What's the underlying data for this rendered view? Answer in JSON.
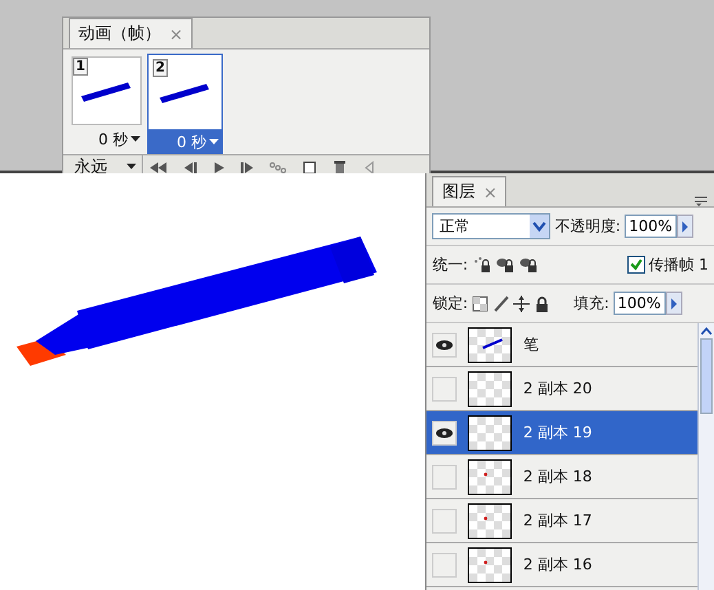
{
  "animation_panel": {
    "tab": {
      "label": "动画（帧）",
      "close": "×"
    },
    "frames": [
      {
        "number": "1",
        "delay": "0 秒",
        "selected": false
      },
      {
        "number": "2",
        "delay": "0 秒",
        "selected": true
      }
    ],
    "loop": "永远"
  },
  "layers_panel": {
    "tab": {
      "label": "图层",
      "close": "×"
    },
    "blend_mode": "正常",
    "opacity_label": "不透明度:",
    "opacity": "100%",
    "unify_label": "统一:",
    "propagate": {
      "label": "传播帧 1",
      "checked": true
    },
    "lock_label": "锁定:",
    "fill_label": "填充:",
    "fill": "100%",
    "layers": [
      {
        "name": "笔",
        "visible": true,
        "selected": false,
        "kind": "stroke"
      },
      {
        "name": "2 副本 20",
        "visible": false,
        "selected": false,
        "kind": "empty"
      },
      {
        "name": "2 副本 19",
        "visible": true,
        "selected": true,
        "kind": "empty"
      },
      {
        "name": "2 副本 18",
        "visible": false,
        "selected": false,
        "kind": "dot"
      },
      {
        "name": "2 副本 17",
        "visible": false,
        "selected": false,
        "kind": "dot"
      },
      {
        "name": "2 副本 16",
        "visible": false,
        "selected": false,
        "kind": "dot"
      }
    ]
  }
}
